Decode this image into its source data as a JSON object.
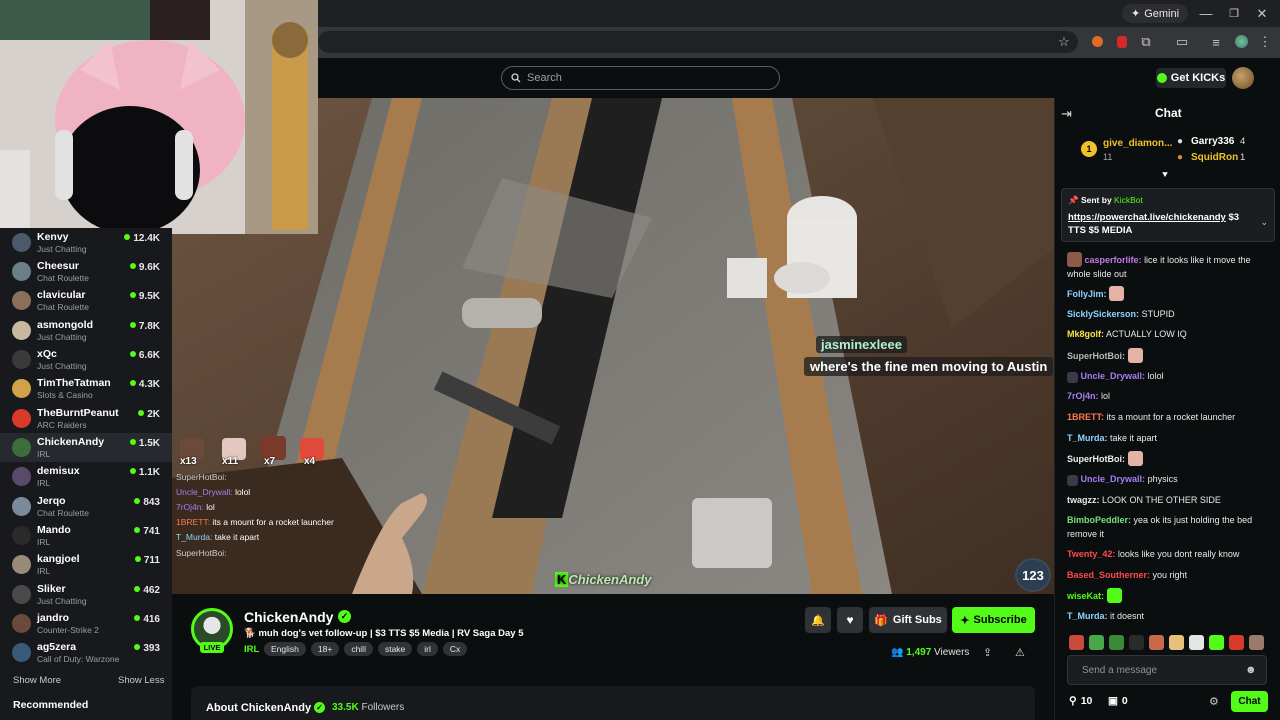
{
  "browser": {
    "gemini_label": "Gemini"
  },
  "header": {
    "search_placeholder": "Search",
    "get_kicks_label": "Get KICKs"
  },
  "sidebar": {
    "channels": [
      {
        "name": "Kenvy",
        "category": "Just Chatting",
        "viewers": "12.4K",
        "color": "#4a5a6a"
      },
      {
        "name": "Cheesur",
        "category": "Chat Roulette",
        "viewers": "9.6K",
        "color": "#6a7f8a"
      },
      {
        "name": "clavicular",
        "category": "Chat Roulette",
        "viewers": "9.5K",
        "color": "#8a6f5a"
      },
      {
        "name": "asmongold",
        "category": "Just Chatting",
        "viewers": "7.8K",
        "color": "#c7b8a0"
      },
      {
        "name": "xQc",
        "category": "Just Chatting",
        "viewers": "6.6K",
        "color": "#3a3a3a"
      },
      {
        "name": "TimTheTatman",
        "category": "Slots & Casino",
        "viewers": "4.3K",
        "color": "#d2a24a"
      },
      {
        "name": "TheBurntPeanut",
        "category": "ARC Raiders",
        "viewers": "2K",
        "color": "#d83a2a"
      },
      {
        "name": "ChickenAndy",
        "category": "IRL",
        "viewers": "1.5K",
        "color": "#3c6e3a"
      },
      {
        "name": "demisux",
        "category": "IRL",
        "viewers": "1.1K",
        "color": "#5a4a6a"
      },
      {
        "name": "Jerqo",
        "category": "Chat Roulette",
        "viewers": "843",
        "color": "#7a8a9a"
      },
      {
        "name": "Mando",
        "category": "IRL",
        "viewers": "741",
        "color": "#2a2a2a"
      },
      {
        "name": "kangjoel",
        "category": "IRL",
        "viewers": "711",
        "color": "#9a8a7a"
      },
      {
        "name": "Sliker",
        "category": "Just Chatting",
        "viewers": "462",
        "color": "#4a4a4a"
      },
      {
        "name": "jandro",
        "category": "Counter-Strike 2",
        "viewers": "416",
        "color": "#6a4a3a"
      },
      {
        "name": "ag5zera",
        "category": "Call of Duty: Warzone",
        "viewers": "393",
        "color": "#3a5a7a"
      }
    ],
    "show_more": "Show More",
    "show_less": "Show Less",
    "recommended": "Recommended"
  },
  "video": {
    "caption_user": "jasminexleee",
    "caption_text": "where's the fine men moving to Austin",
    "watermark": "ChickenAndy",
    "viewer_bubble": "123",
    "emote_counts": [
      "x13",
      "x11",
      "x7",
      "x4"
    ],
    "overlay_chat": [
      {
        "user": "SuperHotBoi:",
        "text": "",
        "color": "#cfcfcf"
      },
      {
        "user": "Uncle_Drywall:",
        "text": "lolol",
        "color": "#a77ef0"
      },
      {
        "user": "7rOj4n:",
        "text": "lol",
        "color": "#a77ef0"
      },
      {
        "user": "1BRETT:",
        "text": "its a mount for a rocket launcher",
        "color": "#ff7a4a"
      },
      {
        "user": "T_Murda:",
        "text": "take it apart",
        "color": "#8fd4ff"
      },
      {
        "user": "SuperHotBoi:",
        "text": "",
        "color": "#cfcfcf"
      }
    ]
  },
  "stream": {
    "channel_name": "ChickenAndy",
    "live_badge": "LIVE",
    "title": "muh dog's vet follow-up | $3 TTS $5 Media | RV Saga Day 5",
    "category": "IRL",
    "tags": [
      "English",
      "18+",
      "chill",
      "stake",
      "irl",
      "Cx"
    ],
    "gift_subs_label": "Gift Subs",
    "subscribe_label": "Subscribe",
    "viewers_count": "1,497",
    "viewers_label": "Viewers",
    "about_title": "About ChickenAndy",
    "followers_count": "33.5K",
    "followers_label": "Followers"
  },
  "chat": {
    "title": "Chat",
    "top_gifters": [
      {
        "rank": "1",
        "name": "give_diamon...",
        "count": "11"
      },
      {
        "rank": "",
        "name": "Garry336",
        "count": "4"
      },
      {
        "rank": "",
        "name": "SquidRon",
        "count": "1"
      }
    ],
    "pinned": {
      "sent_by_label": "Sent by",
      "sender": "KickBot",
      "link": "https://powerchat.live/chickenandy",
      "text": "$3 TTS $5 MEDIA"
    },
    "messages": [
      {
        "user": "casperforlife:",
        "text": "lice it looks like it move the whole slide out",
        "color": "#c07be8"
      },
      {
        "user": "FollyJim:",
        "text": "",
        "color": "#8fd4ff"
      },
      {
        "user": "SicklySickerson:",
        "text": "STUPID",
        "color": "#8fd4ff"
      },
      {
        "user": "Mk8golf:",
        "text": "ACTUALLY LOW IQ",
        "color": "#f6e14a"
      },
      {
        "user": "SuperHotBoi:",
        "text": "",
        "color": "#b9b9b9"
      },
      {
        "user": "Uncle_Drywall:",
        "text": "lolol",
        "color": "#a77ef0"
      },
      {
        "user": "7rOj4n:",
        "text": "lol",
        "color": "#a77ef0"
      },
      {
        "user": "1BRETT:",
        "text": "its a mount for a rocket launcher",
        "color": "#ff7a4a"
      },
      {
        "user": "T_Murda:",
        "text": "take it apart",
        "color": "#8fd4ff"
      },
      {
        "user": "SuperHotBoi:",
        "text": "",
        "color": "#f0f0f0"
      },
      {
        "user": "Uncle_Drywall:",
        "text": "physics",
        "color": "#a77ef0"
      },
      {
        "user": "twagzz:",
        "text": "LOOK ON THE OTHER SIDE",
        "color": "#e9e9e9"
      },
      {
        "user": "BimboPeddler:",
        "text": "yea ok its just holding the bed remove it",
        "color": "#72e27a"
      },
      {
        "user": "Twenty_42:",
        "text": "looks like you dont really know",
        "color": "#ff4a4a"
      },
      {
        "user": "Based_Southerner:",
        "text": "you right",
        "color": "#ff4a4a"
      },
      {
        "user": "wiseKat:",
        "text": "",
        "color": "#53fc18"
      },
      {
        "user": "T_Murda:",
        "text": "it doesnt",
        "color": "#8fd4ff"
      }
    ],
    "input_placeholder": "Send a message",
    "points_count": "10",
    "wallet_count": "0",
    "chat_button_label": "Chat"
  },
  "colors": {
    "accent": "#53fc18",
    "background": "#0b0e0f",
    "sidebar": "#17191c"
  }
}
